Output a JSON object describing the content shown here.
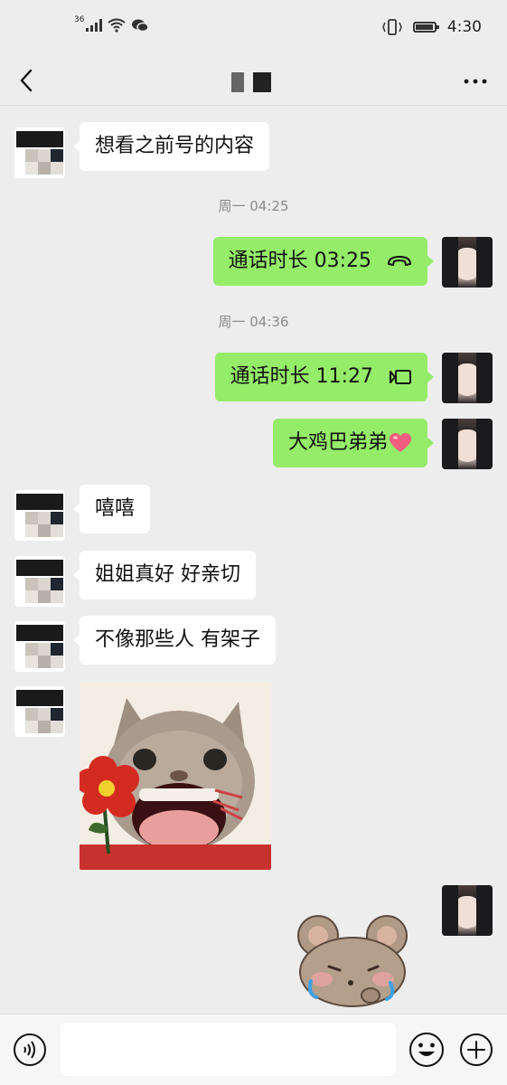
{
  "status_bar": {
    "network_label": "36",
    "signal_icon": "signal-icon",
    "wifi_icon": "wifi-icon",
    "wechat_icon": "wechat-icon",
    "vibrate_icon": "vibrate-icon",
    "battery_icon": "battery-icon",
    "time": "4:30"
  },
  "nav": {
    "back_icon": "back-arrow-icon",
    "title": "",
    "more_icon": "more-dots-icon"
  },
  "messages": [
    {
      "sender": "peer",
      "type": "text",
      "text": "想看之前号的内容"
    },
    {
      "type": "time",
      "text": "周一 04:25"
    },
    {
      "sender": "self",
      "type": "call",
      "text": "通话时长 03:25",
      "icon": "phone-hangup-icon"
    },
    {
      "type": "time",
      "text": "周一 04:36"
    },
    {
      "sender": "self",
      "type": "call",
      "text": "通话时长 11:27",
      "icon": "video-call-icon"
    },
    {
      "sender": "self",
      "type": "text",
      "text": "大鸡巴弟弟",
      "emoji": "heart-emoji-icon"
    },
    {
      "sender": "peer",
      "type": "text",
      "text": "嘻嘻"
    },
    {
      "sender": "peer",
      "type": "text",
      "text": "姐姐真好 好亲切"
    },
    {
      "sender": "peer",
      "type": "text",
      "text": "不像那些人 有架子"
    },
    {
      "sender": "peer",
      "type": "sticker",
      "sticker": "cat-with-flower-sticker"
    },
    {
      "sender": "self",
      "type": "sticker",
      "sticker": "crying-bear-sticker"
    }
  ],
  "input_bar": {
    "voice_icon": "voice-icon",
    "input_value": "",
    "emoji_icon": "emoji-icon",
    "plus_icon": "plus-icon"
  },
  "colors": {
    "background": "#ededed",
    "self_bubble": "#95ec69",
    "peer_bubble": "#ffffff",
    "timestamp": "#8a8a8a"
  }
}
